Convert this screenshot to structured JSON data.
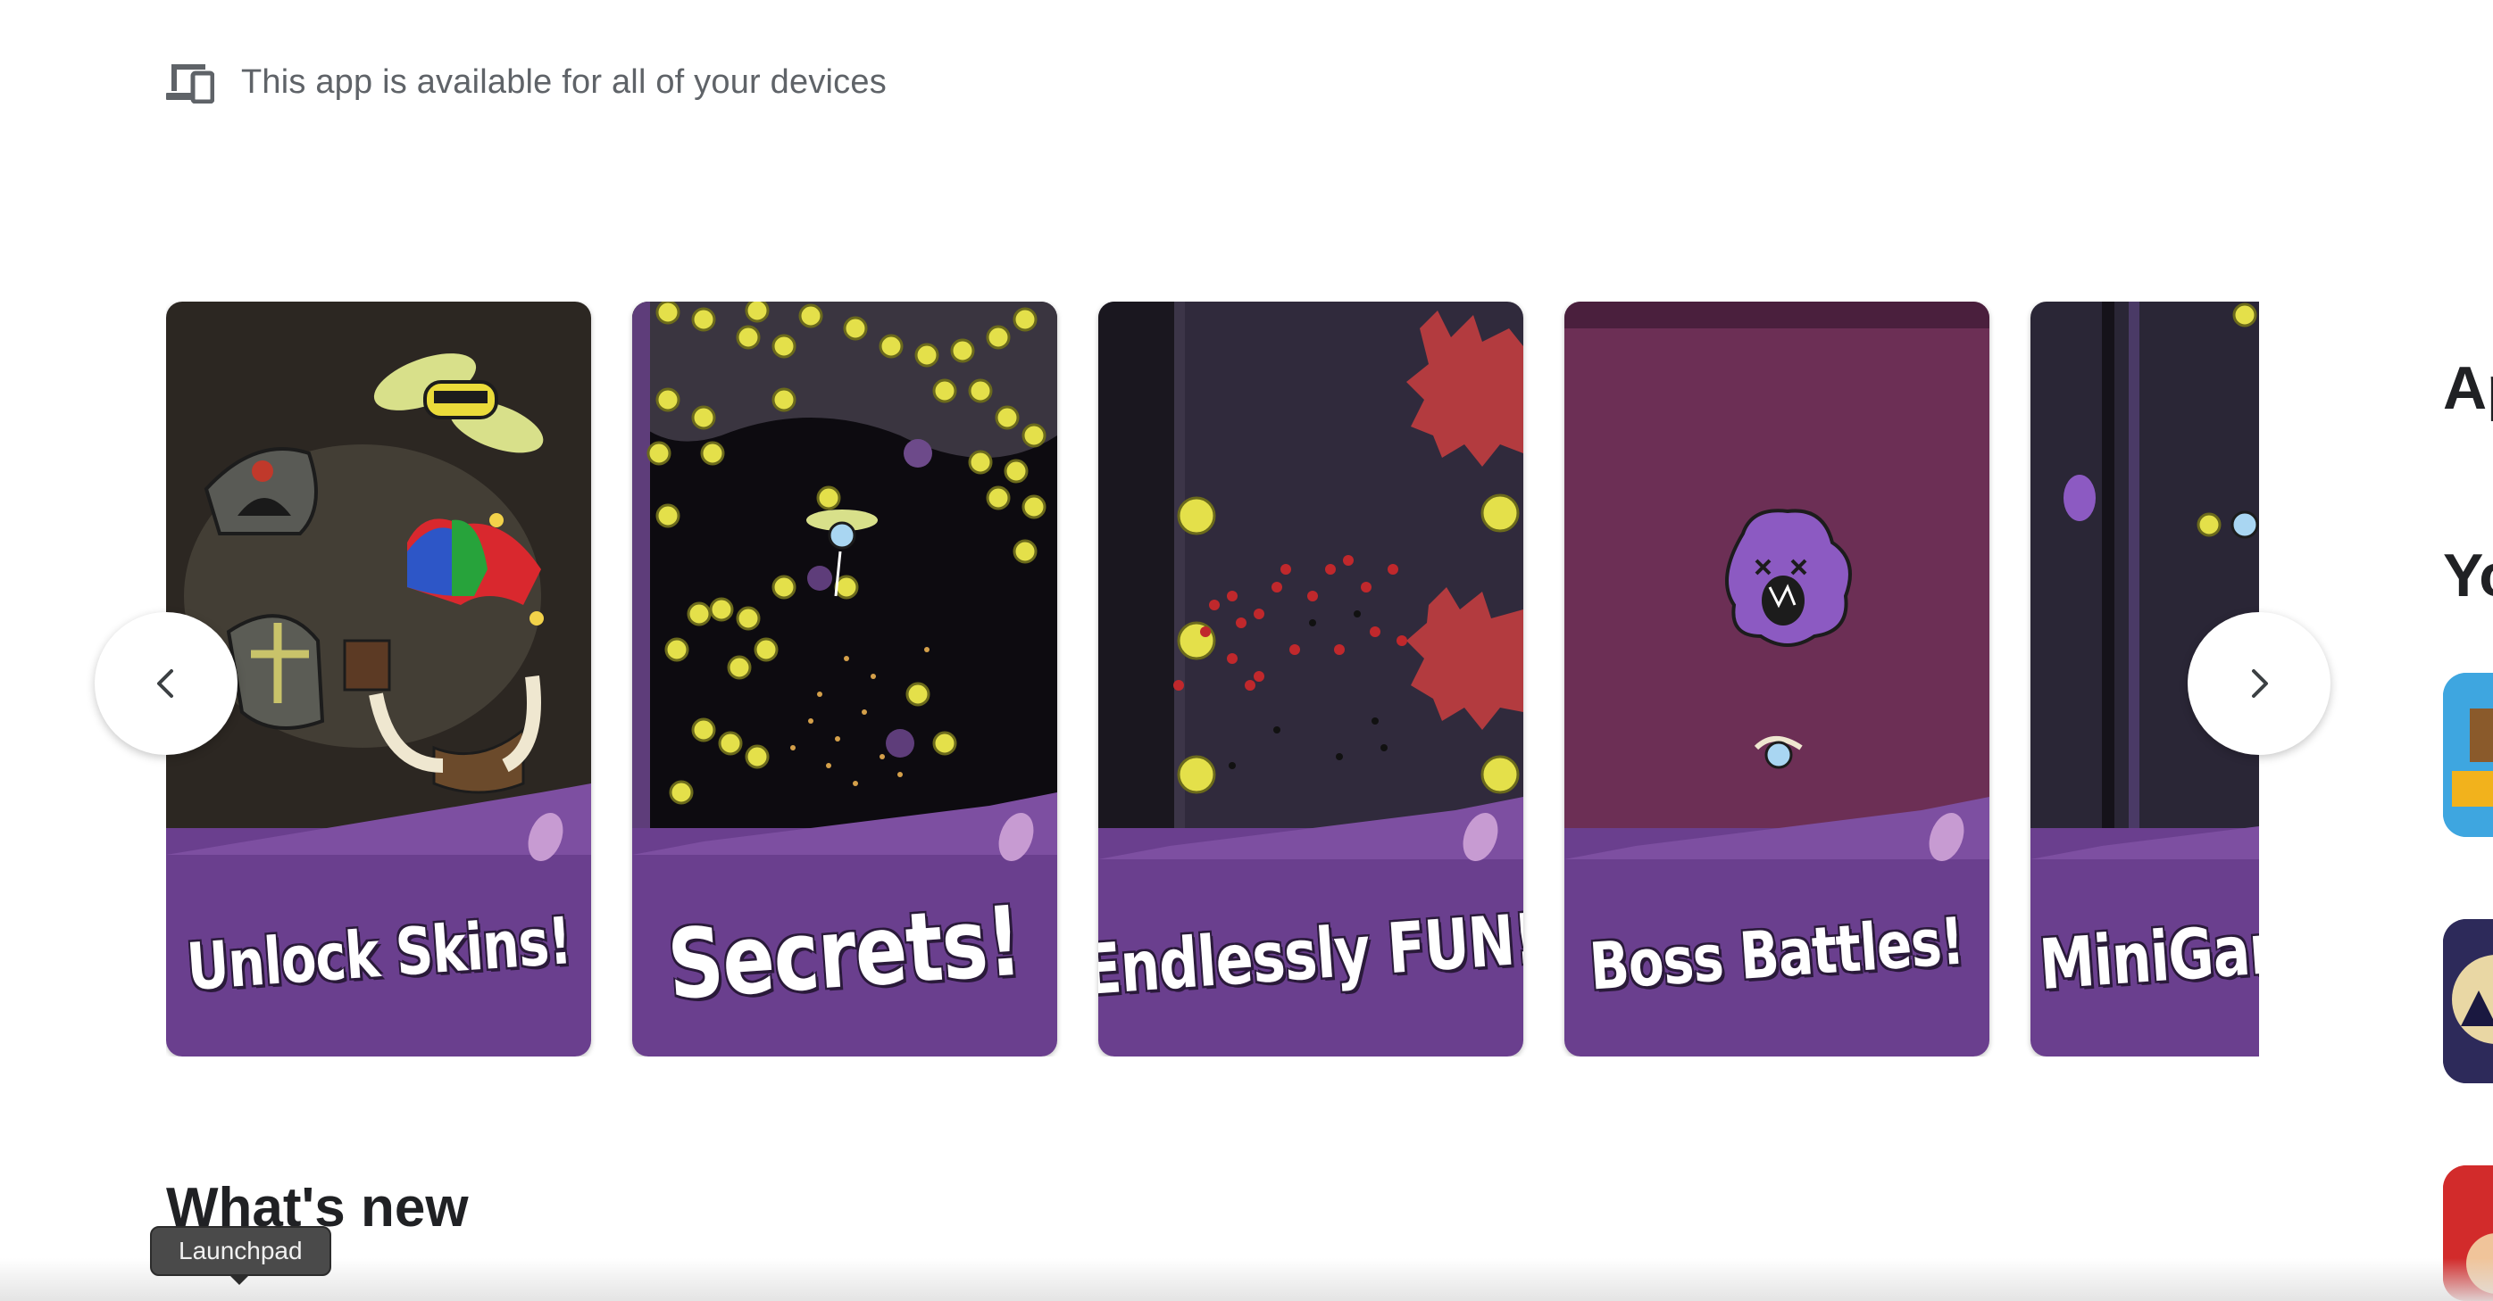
{
  "availability": {
    "icon": "devices-icon",
    "text": "This app is available for all of your devices"
  },
  "carousel": {
    "screenshots": [
      {
        "caption": "Unlock Skins!"
      },
      {
        "caption": "Secrets!"
      },
      {
        "caption": "Endlessly FUN!"
      },
      {
        "caption": "Boss Battles!"
      },
      {
        "caption": "MiniGame"
      }
    ],
    "prev_icon": "chevron-left-icon",
    "next_icon": "chevron-right-icon"
  },
  "sidebar": {
    "heading_1": "Ap",
    "heading_2": "Yo"
  },
  "whats_new": {
    "title": "What's new"
  },
  "dock": {
    "tooltip": "Launchpad"
  },
  "colors": {
    "banner_purple": "#6a3f8e",
    "text_gray": "#5f6368"
  }
}
